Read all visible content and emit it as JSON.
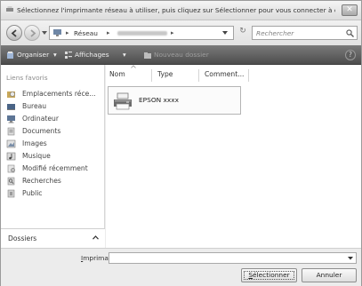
{
  "window": {
    "title": "Sélectionnez l'imprimante réseau à utiliser, puis cliquez sur Sélectionner pour vous connecter à cette..."
  },
  "navbar": {
    "address_root": "Réseau",
    "search_placeholder": "Rechercher"
  },
  "toolbar": {
    "organize_label": "Organiser",
    "views_label": "Affichages",
    "new_folder_label": "Nouveau dossier",
    "help_label": "?"
  },
  "sidebar": {
    "header": "Liens favoris",
    "items": [
      {
        "label": "Emplacements réce...",
        "icon": "recent-places-icon"
      },
      {
        "label": "Bureau",
        "icon": "desktop-icon"
      },
      {
        "label": "Ordinateur",
        "icon": "computer-icon"
      },
      {
        "label": "Documents",
        "icon": "documents-icon"
      },
      {
        "label": "Images",
        "icon": "pictures-icon"
      },
      {
        "label": "Musique",
        "icon": "music-icon"
      },
      {
        "label": "Modifié récemment",
        "icon": "recently-changed-icon"
      },
      {
        "label": "Recherches",
        "icon": "searches-icon"
      },
      {
        "label": "Public",
        "icon": "public-icon"
      }
    ],
    "folders_label": "Dossiers"
  },
  "content": {
    "columns": [
      "Nom",
      "Type",
      "Comment..."
    ],
    "items": [
      {
        "name": "EPSON xxxx",
        "icon": "printer-icon"
      }
    ]
  },
  "bottom": {
    "printer_label_prefix": "I",
    "printer_label_rest": "mprimante",
    "printer_value": "",
    "select_label_prefix": "S",
    "select_label_rest": "électionner",
    "cancel_label": "Annuler"
  }
}
